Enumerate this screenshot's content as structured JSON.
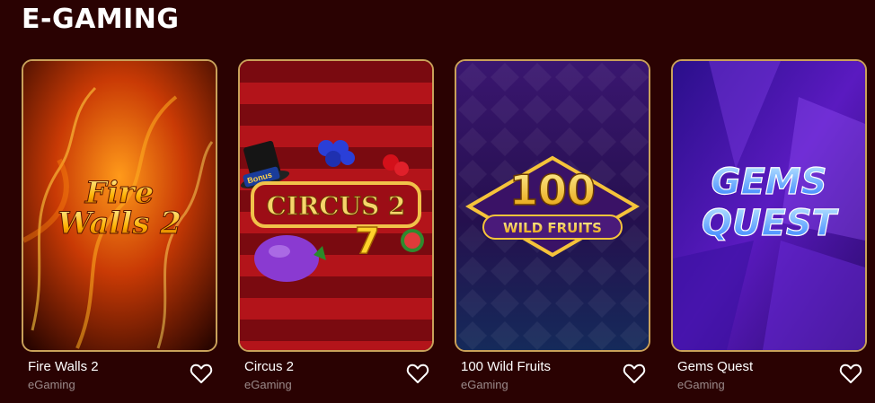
{
  "section": {
    "title": "E-GAMING"
  },
  "games": [
    {
      "name": "Fire Walls 2",
      "provider": "eGaming",
      "art_text": [
        "Fire",
        "Walls 2"
      ]
    },
    {
      "name": "Circus 2",
      "provider": "eGaming",
      "art_text": [
        "CIRCUS 2",
        "Bonus"
      ]
    },
    {
      "name": "100 Wild Fruits",
      "provider": "eGaming",
      "art_text": [
        "100",
        "WILD FRUITS"
      ]
    },
    {
      "name": "Gems Quest",
      "provider": "eGaming",
      "art_text": [
        "GEMS",
        "QUEST"
      ]
    }
  ],
  "icons": {
    "favorite": "heart-outline-icon"
  },
  "colors": {
    "background": "#2a0202",
    "card_border": "#c9a15a",
    "provider_text": "#9a8a8a"
  }
}
